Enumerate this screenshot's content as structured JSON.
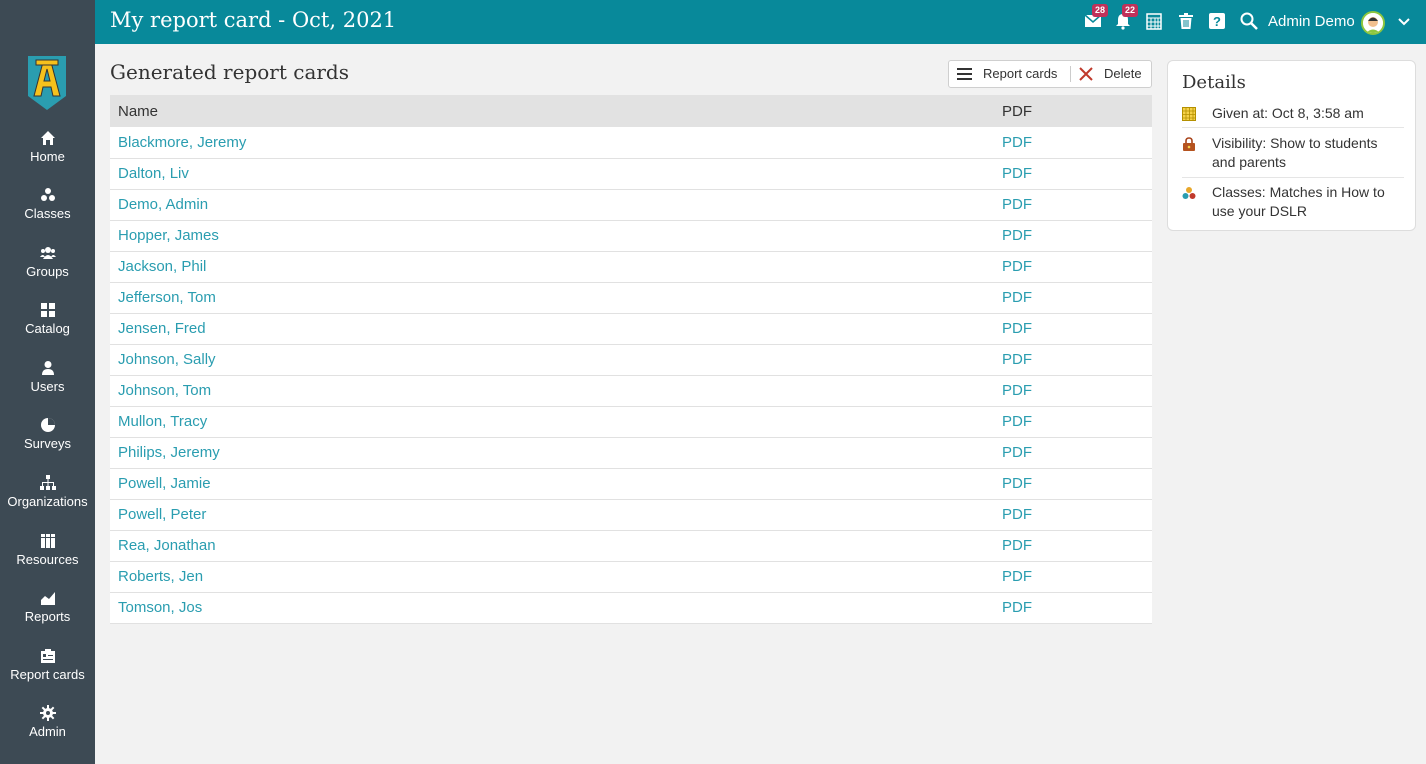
{
  "header": {
    "title": "My report card - Oct, 2021",
    "messages_count": "28",
    "notifications_count": "22",
    "user_name": "Admin Demo"
  },
  "sidebar": {
    "items": [
      {
        "label": "Home",
        "icon": "home-icon"
      },
      {
        "label": "Classes",
        "icon": "classes-icon"
      },
      {
        "label": "Groups",
        "icon": "groups-icon"
      },
      {
        "label": "Catalog",
        "icon": "catalog-icon"
      },
      {
        "label": "Users",
        "icon": "users-icon"
      },
      {
        "label": "Surveys",
        "icon": "surveys-icon"
      },
      {
        "label": "Organizations",
        "icon": "organizations-icon"
      },
      {
        "label": "Resources",
        "icon": "resources-icon"
      },
      {
        "label": "Reports",
        "icon": "reports-icon"
      },
      {
        "label": "Report cards",
        "icon": "report-cards-icon"
      },
      {
        "label": "Admin",
        "icon": "admin-gear-icon"
      }
    ]
  },
  "main": {
    "title": "Generated report cards",
    "toolbar": {
      "report_cards_label": "Report cards",
      "delete_label": "Delete"
    },
    "table": {
      "headers": {
        "name": "Name",
        "pdf": "PDF"
      },
      "rows": [
        {
          "name": "Blackmore, Jeremy",
          "pdf": "PDF"
        },
        {
          "name": "Dalton, Liv",
          "pdf": "PDF"
        },
        {
          "name": "Demo, Admin",
          "pdf": "PDF"
        },
        {
          "name": "Hopper, James",
          "pdf": "PDF"
        },
        {
          "name": "Jackson, Phil",
          "pdf": "PDF"
        },
        {
          "name": "Jefferson, Tom",
          "pdf": "PDF"
        },
        {
          "name": "Jensen, Fred",
          "pdf": "PDF"
        },
        {
          "name": "Johnson, Sally",
          "pdf": "PDF"
        },
        {
          "name": "Johnson, Tom",
          "pdf": "PDF"
        },
        {
          "name": "Mullon, Tracy",
          "pdf": "PDF"
        },
        {
          "name": "Philips, Jeremy",
          "pdf": "PDF"
        },
        {
          "name": "Powell, Jamie",
          "pdf": "PDF"
        },
        {
          "name": "Powell, Peter",
          "pdf": "PDF"
        },
        {
          "name": "Rea, Jonathan",
          "pdf": "PDF"
        },
        {
          "name": "Roberts, Jen",
          "pdf": "PDF"
        },
        {
          "name": "Tomson, Jos",
          "pdf": "PDF"
        }
      ]
    }
  },
  "details": {
    "title": "Details",
    "given_at": "Given at: Oct 8, 3:58 am",
    "visibility": "Visibility: Show to students and parents",
    "classes": "Classes: Matches in How to use your DSLR"
  },
  "colors": {
    "header_bg": "#08899a",
    "sidebar_bg": "#3d4a54",
    "link": "#2a9db0",
    "badge": "#c0315a",
    "delete_x": "#c0392b"
  }
}
